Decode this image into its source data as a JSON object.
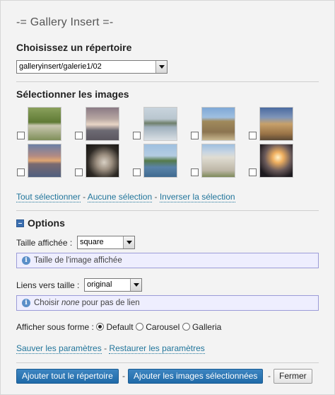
{
  "header": {
    "title": "-= Gallery Insert =-"
  },
  "directory": {
    "heading": "Choisissez un répertoire",
    "selected": "galleryinsert/galerie1/02"
  },
  "images": {
    "heading": "Sélectionner les images",
    "items": [
      {
        "icon": "thumb-waterfall"
      },
      {
        "icon": "thumb-sunset-sea"
      },
      {
        "icon": "thumb-harbor"
      },
      {
        "icon": "thumb-gateway-arch"
      },
      {
        "icon": "thumb-colonial-building"
      },
      {
        "icon": "thumb-city-sunset"
      },
      {
        "icon": "thumb-monkey"
      },
      {
        "icon": "thumb-coast-fort"
      },
      {
        "icon": "thumb-church"
      },
      {
        "icon": "thumb-palm-sunset"
      }
    ],
    "select_all": "Tout sélectionner",
    "select_none": "Aucune sélection",
    "invert": "Inverser la sélection",
    "separator": "-"
  },
  "options": {
    "heading": "Options",
    "size_label": "Taille affichée :",
    "size_value": "square",
    "size_info": "Taille de l'image affichée",
    "link_label": "Liens vers taille :",
    "link_value": "original",
    "link_info_prefix": "Choisir ",
    "link_info_em": "none",
    "link_info_suffix": " pour pas de lien",
    "display_label": "Afficher sous forme :",
    "display_options": [
      "Default",
      "Carousel",
      "Galleria"
    ],
    "display_selected": "Default",
    "save": "Sauver les paramètres",
    "restore": "Restaurer les paramètres"
  },
  "footer": {
    "add_directory": "Ajouter tout le répertoire",
    "add_selected": "Ajouter les images sélectionnées",
    "close": "Fermer",
    "separator": "-"
  },
  "colors": {
    "link": "#21759b",
    "button": "#2a74b3",
    "info_bg": "#eeeefe"
  }
}
